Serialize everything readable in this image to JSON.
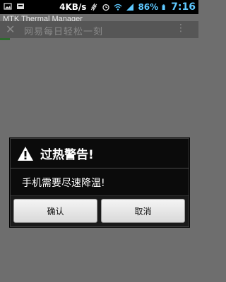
{
  "status_bar": {
    "net_speed": "4KB/s",
    "battery": "86%",
    "time": "7:16"
  },
  "overlay_title": "MTK Thermal Manager",
  "underlying_app": {
    "title": "网易每日轻松一刻"
  },
  "dialog": {
    "title": "过热警告!",
    "message": "手机需要尽速降温!",
    "confirm_label": "确认",
    "cancel_label": "取消"
  },
  "colors": {
    "accent": "#5ec8ff",
    "dialog_bg": "#0b0b0b",
    "dimmed_bg": "#6e6e6e"
  },
  "icons": [
    "image-icon",
    "mail-icon",
    "flash-off-icon",
    "alarm-icon",
    "wifi-icon",
    "signal-icon",
    "battery-icon",
    "back-icon",
    "more-icon",
    "warning-icon"
  ]
}
